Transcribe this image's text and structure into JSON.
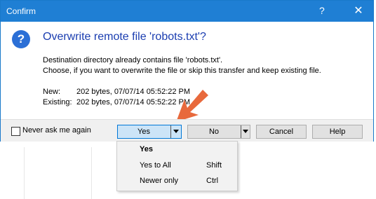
{
  "window": {
    "title": "Confirm",
    "help_glyph": "?",
    "close_glyph": "✕"
  },
  "message": {
    "heading": "Overwrite remote file 'robots.txt'?",
    "line1": "Destination directory already contains file 'robots.txt'.",
    "line2": "Choose, if you want to overwrite the file or skip this transfer and keep existing file."
  },
  "files": {
    "new_label": "New:",
    "new_value": "202 bytes, 07/07/14 05:52:22 PM",
    "existing_label": "Existing:",
    "existing_value": "202 bytes, 07/07/14 05:52:22 PM"
  },
  "footer": {
    "never_ask_label": "Never ask me again",
    "never_ask_checked": false,
    "yes_label": "Yes",
    "no_label": "No",
    "cancel_label": "Cancel",
    "help_label": "Help"
  },
  "menu": {
    "items": [
      {
        "label": "Yes",
        "shortcut": ""
      },
      {
        "label": "Yes to All",
        "shortcut": "Shift"
      },
      {
        "label": "Newer only",
        "shortcut": "Ctrl"
      }
    ]
  },
  "colors": {
    "titlebar": "#1f7fd4",
    "heading": "#1a3db0",
    "arrow": "#e8693c",
    "default_button": "#cce4f7"
  },
  "icons": {
    "question": "question-icon",
    "arrow": "pointer-arrow"
  }
}
